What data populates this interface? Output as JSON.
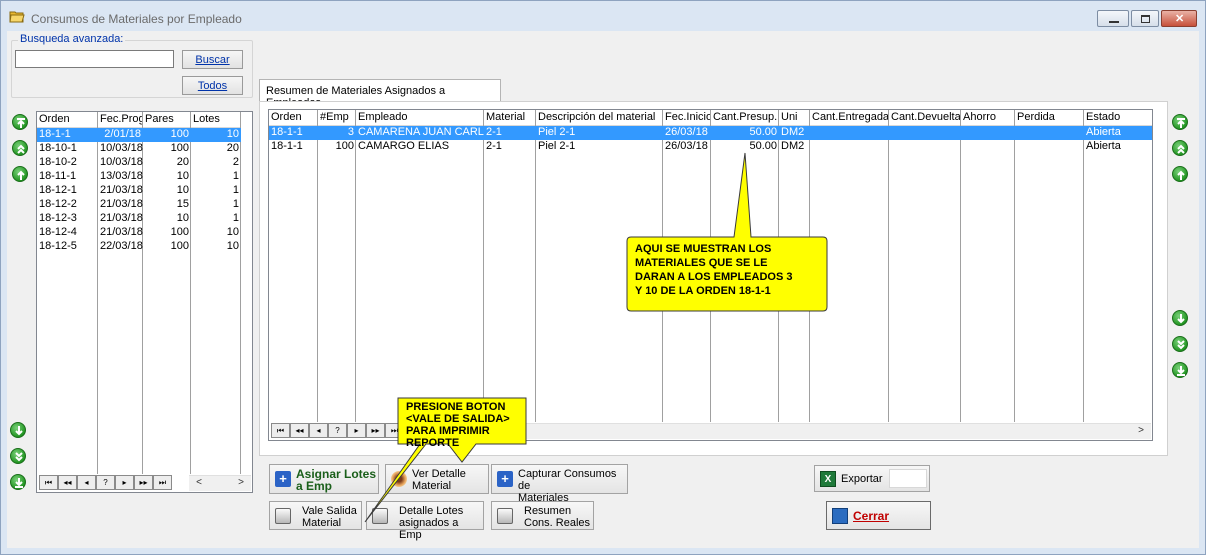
{
  "window": {
    "title": "Consumos de Materiales por Empleado",
    "min_glyph": "–",
    "max_glyph": "▣",
    "close_glyph": "✕"
  },
  "search": {
    "legend": "Busqueda avanzada:",
    "value": "",
    "buscar_label": "Buscar",
    "todos_label": "Todos"
  },
  "orders_grid": {
    "headers": [
      "Orden",
      "Fec.Prog",
      "Pares",
      "Lotes"
    ],
    "rows": [
      [
        "18-1-1",
        "2/01/18",
        "100",
        "10"
      ],
      [
        "18-10-1",
        "10/03/18",
        "100",
        "20"
      ],
      [
        "18-10-2",
        "10/03/18",
        "20",
        "2"
      ],
      [
        "18-11-1",
        "13/03/18",
        "10",
        "1"
      ],
      [
        "18-12-1",
        "21/03/18",
        "10",
        "1"
      ],
      [
        "18-12-2",
        "21/03/18",
        "15",
        "1"
      ],
      [
        "18-12-3",
        "21/03/18",
        "10",
        "1"
      ],
      [
        "18-12-4",
        "21/03/18",
        "100",
        "10"
      ],
      [
        "18-12-5",
        "22/03/18",
        "100",
        "10"
      ]
    ],
    "selected_index": 0
  },
  "tab": {
    "label": "Resumen de Materiales Asignados a Empleados"
  },
  "materials_grid": {
    "headers": [
      "Orden",
      "#Emp",
      "Empleado",
      "Material",
      "Descripción del material",
      "Fec.Inicio",
      "Cant.Presup.",
      "Uni",
      "Cant.Entregada",
      "Cant.Devuelta",
      "Ahorro",
      "Perdida",
      "Estado"
    ],
    "rows": [
      [
        "18-1-1",
        "3",
        "CAMARENA JUAN CARLOS",
        "2-1",
        "Piel 2-1",
        "26/03/18",
        "50.00",
        "DM2",
        "",
        "",
        "",
        "",
        "Abierta"
      ],
      [
        "18-1-1",
        "100",
        "CAMARGO ELIAS",
        "2-1",
        "Piel 2-1",
        "26/03/18",
        "50.00",
        "DM2",
        "",
        "",
        "",
        "",
        "Abierta"
      ]
    ],
    "selected_index": 0
  },
  "callouts": {
    "materials_note": [
      "AQUI SE MUESTRAN LOS",
      "MATERIALES QUE SE LE",
      "DARAN A LOS EMPLEADOS 3",
      "Y 10 DE LA ORDEN 18-1-1"
    ],
    "print_note": [
      "PRESIONE BOTON",
      "<VALE DE SALIDA>",
      "PARA IMPRIMIR",
      "REPORTE"
    ]
  },
  "nav_glyphs": [
    "⏮",
    "◂◂",
    "◂",
    "?",
    "▸",
    "▸▸",
    "⏭"
  ],
  "actions": {
    "asignar_lotes": [
      "Asignar Lotes",
      "a Emp"
    ],
    "ver_detalle": [
      "Ver Detalle",
      "Material"
    ],
    "capturar_consumos": [
      "Capturar Consumos de",
      "Materiales"
    ],
    "vale_salida": [
      "Vale Salida",
      "Material"
    ],
    "detalle_lotes": [
      "Detalle Lotes",
      "asignados a Emp"
    ],
    "resumen_cons": [
      "Resumen",
      "Cons. Reales"
    ],
    "exportar": "Exportar",
    "cerrar": "Cerrar"
  },
  "colors": {
    "selection": "#3399ff",
    "callout_fill": "#ffff00",
    "green_nav": "#239623",
    "link_blue": "#0033aa",
    "close_red": "#c00000"
  }
}
